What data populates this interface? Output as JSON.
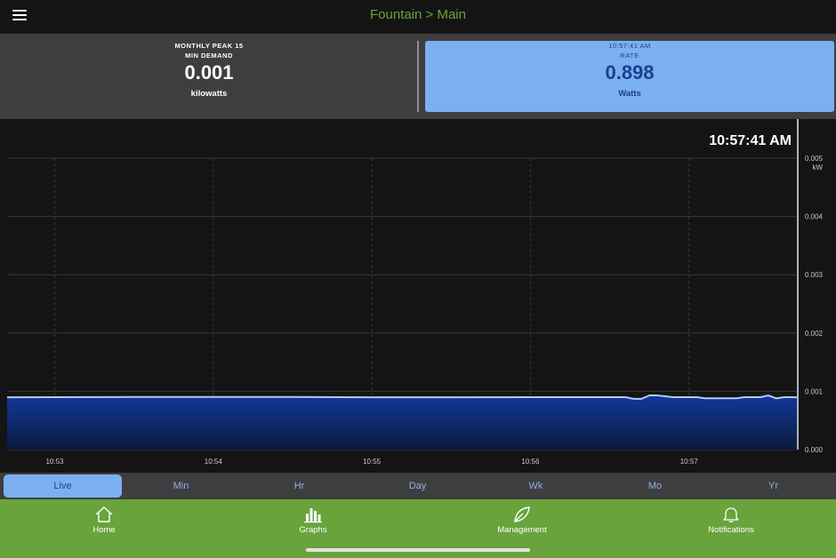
{
  "header": {
    "title": "Fountain > Main",
    "menu_icon": "hamburger-menu-icon"
  },
  "stats": {
    "left": {
      "line1": "MONTHLY PEAK 15",
      "line2": "MIN DEMAND",
      "value": "0.001",
      "unit": "kilowatts"
    },
    "right": {
      "line1": "10:57:41 AM",
      "line2": "RATE",
      "value": "0.898",
      "unit": "Watts"
    }
  },
  "chart_data": {
    "type": "area",
    "current_time_label": "10:57:41 AM",
    "y_unit": "kW",
    "yticks": [
      "0.000",
      "0.001",
      "0.002",
      "0.003",
      "0.004",
      "0.005"
    ],
    "ylim": [
      0,
      0.005
    ],
    "xticks": [
      {
        "label": "10:53",
        "minute": 53
      },
      {
        "label": "10:54",
        "minute": 54
      },
      {
        "label": "10:55",
        "minute": 55
      },
      {
        "label": "10:56",
        "minute": 56
      },
      {
        "label": "10:57",
        "minute": 57
      }
    ],
    "xlim": [
      52.7,
      57.68
    ],
    "grid": true,
    "series": [
      {
        "x": [
          52.7,
          53.0,
          53.5,
          54.0,
          54.5,
          55.0,
          55.5,
          56.0,
          56.5,
          56.6,
          56.65,
          56.7,
          56.75,
          56.8,
          56.9,
          57.0,
          57.05,
          57.1,
          57.2,
          57.3,
          57.35,
          57.4,
          57.45,
          57.5,
          57.55,
          57.6,
          57.68
        ],
        "y": [
          0.000898,
          0.0009,
          0.000902,
          0.000902,
          0.000902,
          0.000898,
          0.000898,
          0.0009,
          0.0009,
          0.0009,
          0.00087,
          0.00087,
          0.00093,
          0.00093,
          0.0009,
          0.0009,
          0.0009,
          0.00088,
          0.00088,
          0.00088,
          0.0009,
          0.0009,
          0.0009,
          0.00093,
          0.00088,
          0.0009,
          0.000898
        ]
      }
    ],
    "colors": {
      "line": "#aecbf2",
      "fill_top": "#13389a",
      "fill_bottom": "#0b1a3d"
    }
  },
  "tabs": [
    {
      "label": "Live",
      "active": true
    },
    {
      "label": "Min",
      "active": false
    },
    {
      "label": "Hr",
      "active": false
    },
    {
      "label": "Day",
      "active": false
    },
    {
      "label": "Wk",
      "active": false
    },
    {
      "label": "Mo",
      "active": false
    },
    {
      "label": "Yr",
      "active": false
    }
  ],
  "nav": [
    {
      "label": "Home",
      "icon": "home-icon"
    },
    {
      "label": "Graphs",
      "icon": "bar-chart-icon"
    },
    {
      "label": "Management",
      "icon": "leaf-icon"
    },
    {
      "label": "Notifications",
      "icon": "bell-icon"
    }
  ],
  "colors": {
    "accent_green": "#68a33c",
    "accent_blue": "#7ab0f0",
    "dark_blue_text": "#1c3f8f"
  }
}
